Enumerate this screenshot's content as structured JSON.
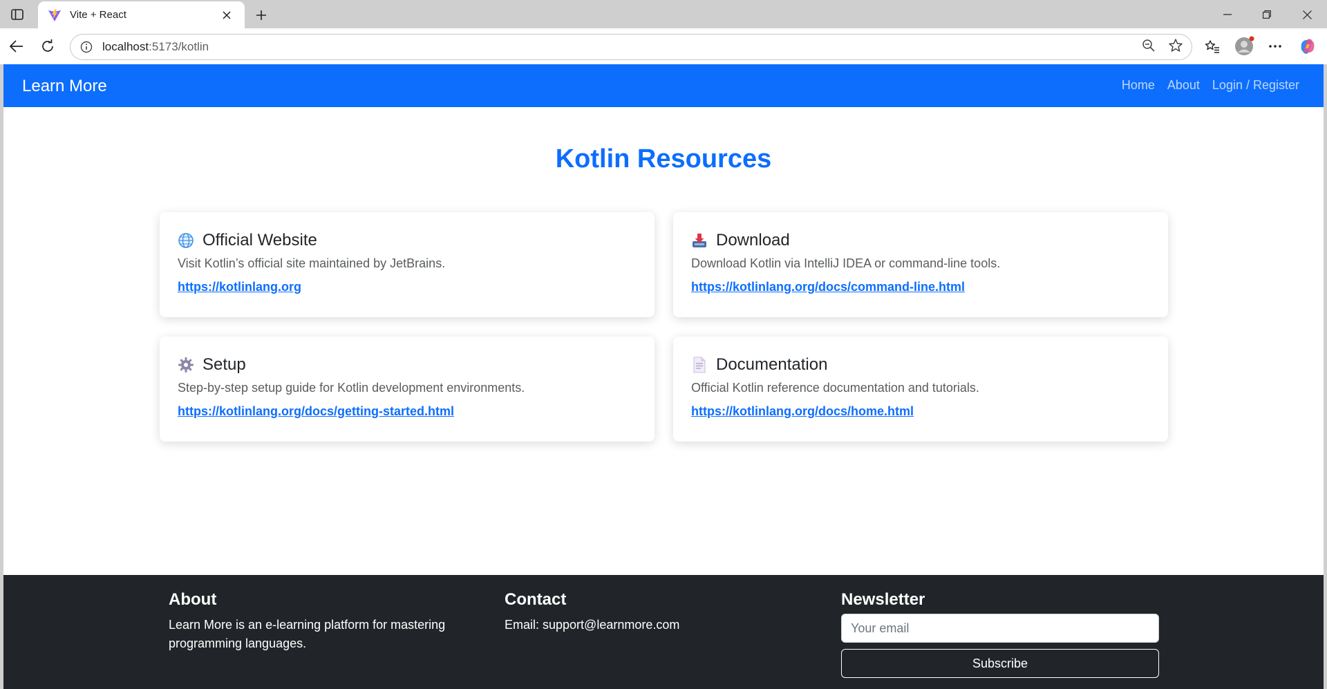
{
  "browser": {
    "tab_title": "Vite + React",
    "address": {
      "host": "localhost",
      "path": ":5173/kotlin"
    }
  },
  "navbar": {
    "brand": "Learn More",
    "links": [
      "Home",
      "About",
      "Login / Register"
    ]
  },
  "main": {
    "heading": "Kotlin Resources",
    "cards": [
      {
        "icon": "globe-icon",
        "title": "Official Website",
        "description": "Visit Kotlin’s official site maintained by JetBrains.",
        "link": "https://kotlinlang.org"
      },
      {
        "icon": "download-tray-icon",
        "title": "Download",
        "description": "Download Kotlin via IntelliJ IDEA or command-line tools.",
        "link": "https://kotlinlang.org/docs/command-line.html"
      },
      {
        "icon": "gear-icon",
        "title": "Setup",
        "description": "Step-by-step setup guide for Kotlin development environments.",
        "link": "https://kotlinlang.org/docs/getting-started.html"
      },
      {
        "icon": "document-icon",
        "title": "Documentation",
        "description": "Official Kotlin reference documentation and tutorials.",
        "link": "https://kotlinlang.org/docs/home.html"
      }
    ]
  },
  "footer": {
    "about": {
      "heading": "About",
      "text": "Learn More is an e-learning platform for mastering programming languages."
    },
    "contact": {
      "heading": "Contact",
      "text": "Email: support@learnmore.com"
    },
    "newsletter": {
      "heading": "Newsletter",
      "placeholder": "Your email",
      "button": "Subscribe"
    }
  },
  "colors": {
    "primary": "#0d6efd",
    "footer_bg": "#212529"
  }
}
